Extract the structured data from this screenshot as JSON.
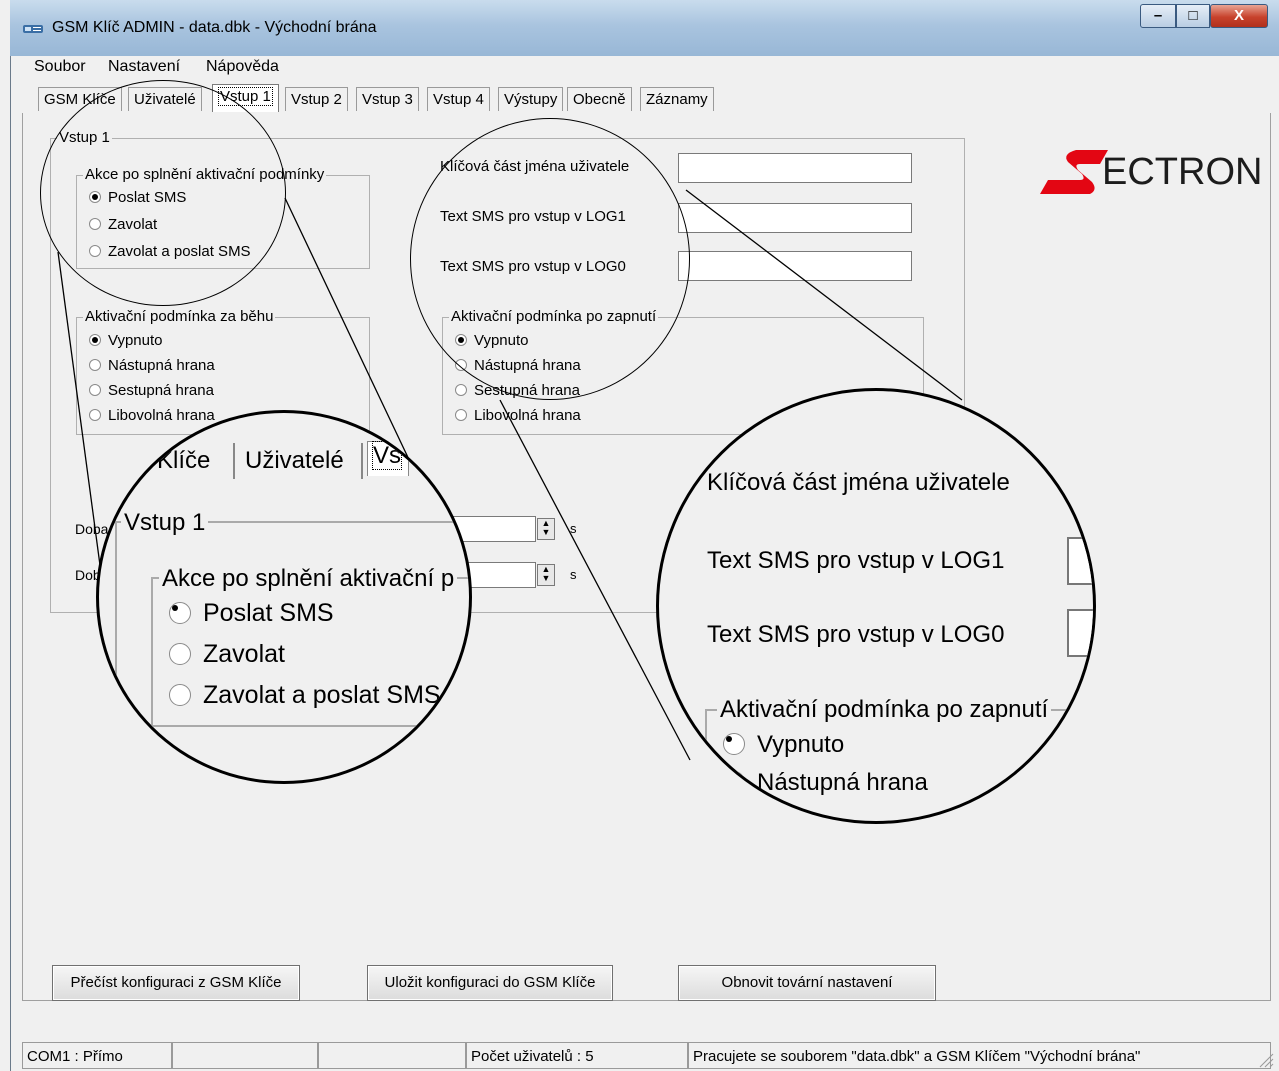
{
  "window": {
    "title": "GSM Klíč ADMIN - data.dbk - Východní brána",
    "minimize_glyph": "–",
    "maximize_glyph": "□",
    "close_glyph": "X"
  },
  "menu": {
    "items": [
      "Soubor",
      "Nastavení",
      "Nápověda"
    ]
  },
  "tabs": [
    "GSM Klíče",
    "Uživatelé",
    "Vstup 1",
    "Vstup 2",
    "Vstup 3",
    "Vstup 4",
    "Výstupy",
    "Obecně",
    "Záznamy"
  ],
  "active_tab": "Vstup 1",
  "panel": {
    "group_title": "Vstup 1",
    "action_group": {
      "title": "Akce po splnění aktivační podmínky",
      "options": [
        "Poslat SMS",
        "Zavolat",
        "Zavolat a poslat SMS"
      ],
      "selected": "Poslat SMS"
    },
    "runtime_group": {
      "title": "Aktivační podmínka za běhu",
      "options": [
        "Vypnuto",
        "Nástupná hrana",
        "Sestupná hrana",
        "Libovolná hrana"
      ],
      "selected": "Vypnuto"
    },
    "startup_group": {
      "title": "Aktivační podmínka po zapnutí",
      "options": [
        "Vypnuto",
        "Nástupná hrana",
        "Sestupná hrana",
        "Libovolná hrana"
      ],
      "selected": "Vypnuto"
    },
    "fields": {
      "user_key_label": "Klíčová část jména uživatele",
      "user_key_value": "",
      "sms_log1_label": "Text SMS pro vstup v LOG1",
      "sms_log1_value": "",
      "sms_log0_label": "Text SMS pro vstup v LOG0",
      "sms_log0_value": ""
    },
    "duration_rows": [
      {
        "label": "Doba",
        "unit": "s"
      },
      {
        "label": "Dob",
        "unit": "s"
      }
    ]
  },
  "logo": {
    "text": "ECTRON",
    "mark": "S",
    "accent_color": "#e30613"
  },
  "buttons": {
    "read_config": "Přečíst konfiguraci z GSM Klíče",
    "save_config": "Uložit konfiguraci do GSM Klíče",
    "factory_reset": "Obnovit tovární nastavení"
  },
  "statusbar": {
    "port": "COM1 : Přímo",
    "cell2": "",
    "cell3": "",
    "user_count": "Počet uživatelů : 5",
    "message": "Pracujete se souborem \"data.dbk\" a GSM Klíčem \"Východní brána\""
  },
  "magnifier_left": {
    "tabs": [
      "Klíče",
      "Uživatelé",
      "Vs"
    ],
    "group_title": "Vstup 1",
    "sub_title": "Akce po splnění aktivační p",
    "options": [
      "Poslat SMS",
      "Zavolat",
      "Zavolat a poslat SMS"
    ]
  },
  "magnifier_right": {
    "labels": [
      "Klíčová část  jména uživatele",
      "Text SMS pro vstup v LOG1",
      "Text SMS pro vstup v LOG0"
    ],
    "group_title": "Aktivační podmínka po zapnutí",
    "options": [
      "Vypnuto",
      "Nástupná hrana"
    ]
  }
}
